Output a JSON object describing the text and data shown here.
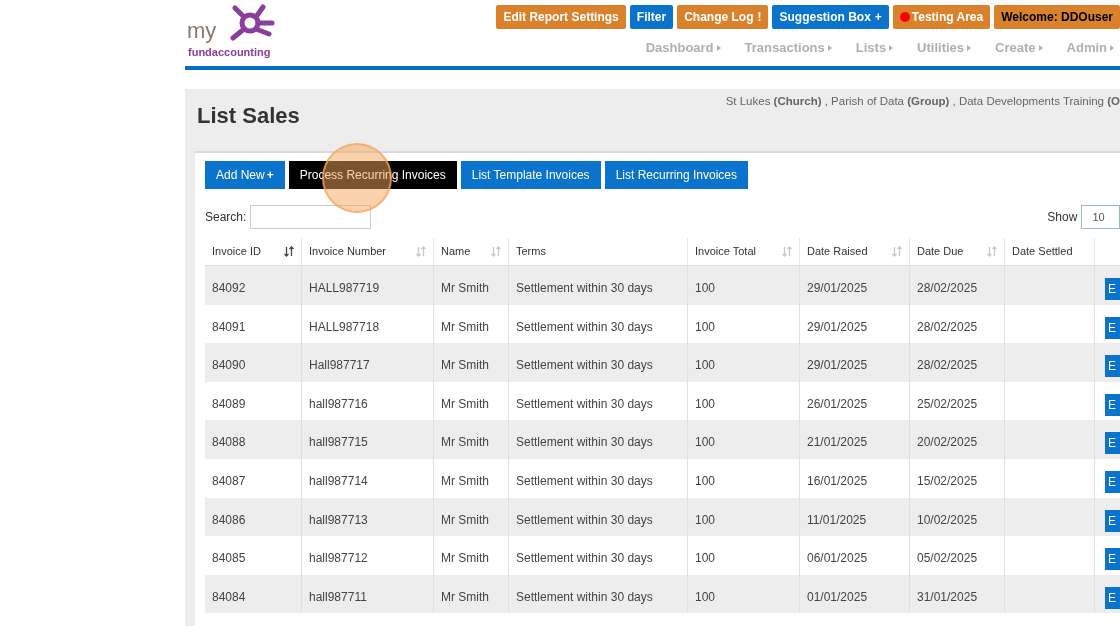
{
  "logo": {
    "word_top": "my",
    "word_bottom": "fundaccounting"
  },
  "top_buttons": [
    {
      "label": "Edit Report Settings",
      "kind": "orange"
    },
    {
      "label": "Filter",
      "kind": "blue"
    },
    {
      "label": "Change Log",
      "kind": "orange",
      "suffix": "!"
    },
    {
      "label": "Suggestion Box",
      "kind": "blue",
      "suffix": "+"
    },
    {
      "label": "Testing Area",
      "kind": "orange-dot"
    },
    {
      "label": "Welcome:  DDOuser",
      "kind": "orange-dark"
    }
  ],
  "nav": [
    {
      "label": "Dashboard"
    },
    {
      "label": "Transactions"
    },
    {
      "label": "Lists"
    },
    {
      "label": "Utilities"
    },
    {
      "label": "Create"
    },
    {
      "label": "Admin"
    }
  ],
  "page_title": "List Sales",
  "breadcrumb": "St Lukes **(Church)** , Parish of Data **(Group)** , Data Developments Training **(O**",
  "actions": [
    {
      "label": "Add New",
      "kind": "blue",
      "suffix": "+"
    },
    {
      "label": "Process Recurring Invoices",
      "kind": "black"
    },
    {
      "label": "List Template Invoices",
      "kind": "blue"
    },
    {
      "label": "List Recurring Invoices",
      "kind": "blue"
    }
  ],
  "search": {
    "label": "Search:"
  },
  "show": {
    "label": "Show",
    "value": "10"
  },
  "table": {
    "columns": [
      {
        "label": "Invoice ID",
        "sortable": true,
        "sorted": true
      },
      {
        "label": "Invoice Number",
        "sortable": true,
        "sorted": false
      },
      {
        "label": "Name",
        "sortable": true,
        "sorted": false
      },
      {
        "label": "Terms",
        "sortable": false
      },
      {
        "label": "Invoice Total",
        "sortable": true,
        "sorted": false
      },
      {
        "label": "Date Raised",
        "sortable": true,
        "sorted": false
      },
      {
        "label": "Date Due",
        "sortable": true,
        "sorted": false
      },
      {
        "label": "Date Settled",
        "sortable": false
      }
    ],
    "rows": [
      {
        "cells": [
          "84092",
          "HALL987719",
          "Mr Smith",
          "Settlement within 30 days",
          "100",
          "29/01/2025",
          "28/02/2025",
          ""
        ],
        "action": "E"
      },
      {
        "cells": [
          "84091",
          "HALL987718",
          "Mr Smith",
          "Settlement within 30 days",
          "100",
          "29/01/2025",
          "28/02/2025",
          ""
        ],
        "action": "E"
      },
      {
        "cells": [
          "84090",
          "Hall987717",
          "Mr Smith",
          "Settlement within 30 days",
          "100",
          "29/01/2025",
          "28/02/2025",
          ""
        ],
        "action": "E"
      },
      {
        "cells": [
          "84089",
          "hall987716",
          "Mr Smith",
          "Settlement within 30 days",
          "100",
          "26/01/2025",
          "25/02/2025",
          ""
        ],
        "action": "E"
      },
      {
        "cells": [
          "84088",
          "hall987715",
          "Mr Smith",
          "Settlement within 30 days",
          "100",
          "21/01/2025",
          "20/02/2025",
          ""
        ],
        "action": "E"
      },
      {
        "cells": [
          "84087",
          "hall987714",
          "Mr Smith",
          "Settlement within 30 days",
          "100",
          "16/01/2025",
          "15/02/2025",
          ""
        ],
        "action": "E"
      },
      {
        "cells": [
          "84086",
          "hall987713",
          "Mr Smith",
          "Settlement within 30 days",
          "100",
          "11/01/2025",
          "10/02/2025",
          ""
        ],
        "action": "E"
      },
      {
        "cells": [
          "84085",
          "hall987712",
          "Mr Smith",
          "Settlement within 30 days",
          "100",
          "06/01/2025",
          "05/02/2025",
          ""
        ],
        "action": "E"
      },
      {
        "cells": [
          "84084",
          "hall987711",
          "Mr Smith",
          "Settlement within 30 days",
          "100",
          "01/01/2025",
          "31/01/2025",
          ""
        ],
        "action": "E"
      }
    ]
  }
}
